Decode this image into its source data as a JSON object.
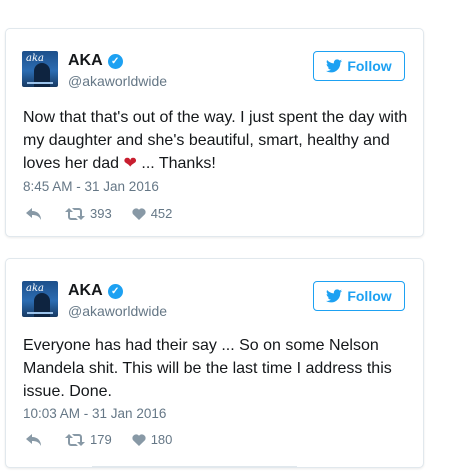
{
  "icons": {
    "verified": "verified-badge-icon",
    "follow": "twitter-bird-icon",
    "reply": "reply-icon",
    "retweet": "retweet-icon",
    "like": "heart-icon"
  },
  "colors": {
    "accent": "#1da1f2",
    "muted": "#657786",
    "heart_emoji": "#c81e2f"
  },
  "tweets": [
    {
      "name": "AKA",
      "handle": "@akaworldwide",
      "follow_label": "Follow",
      "text_before_emoji": "Now that that's out of the way. I just spent the day with my daughter and she's beautiful, smart, healthy and loves her dad ",
      "emoji": "❤",
      "text_after_emoji": " ... Thanks!",
      "timestamp": "8:45 AM - 31 Jan 2016",
      "retweets": "393",
      "likes": "452"
    },
    {
      "name": "AKA",
      "handle": "@akaworldwide",
      "follow_label": "Follow",
      "text": "Everyone has had their say ... So on some Nelson Mandela shit. This will be the last time I address this issue. Done.",
      "timestamp": "10:03 AM - 31 Jan 2016",
      "retweets": "179",
      "likes": "180"
    }
  ]
}
